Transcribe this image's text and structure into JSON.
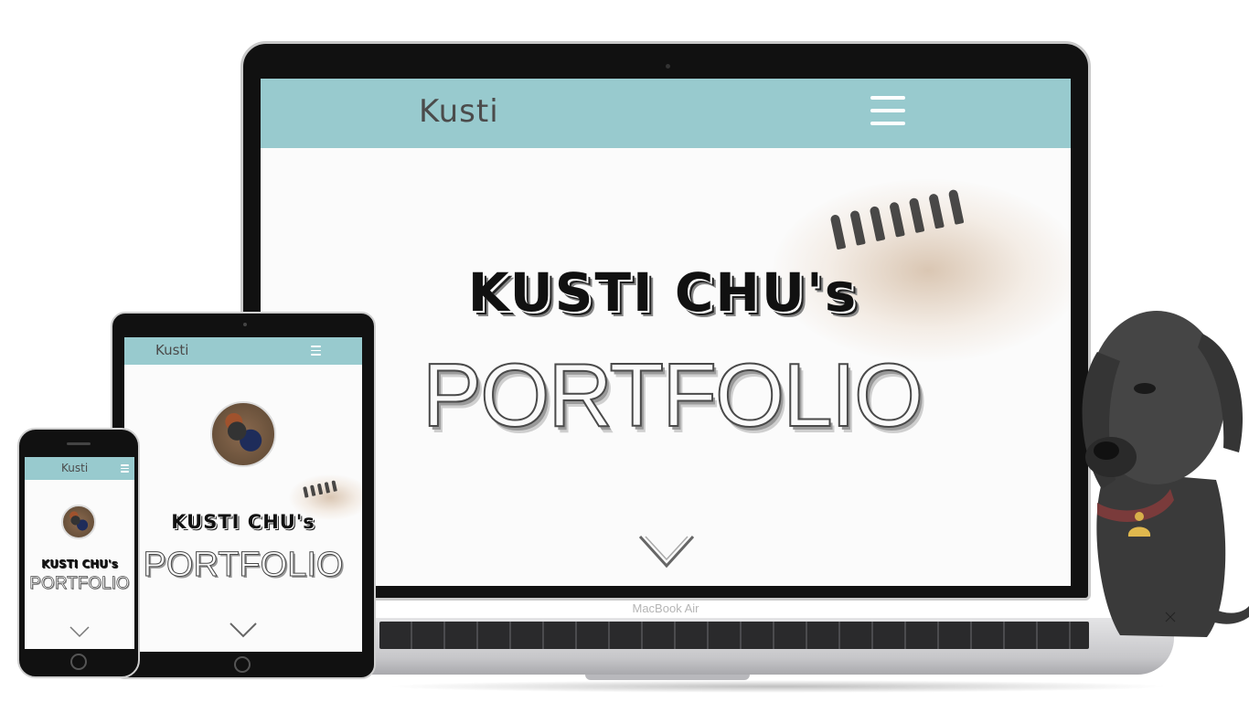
{
  "laptop": {
    "device_label": "MacBook Air",
    "site": {
      "logo_text": "Kusti",
      "title_line1": "KUSTI CHU's",
      "title_line2": "PORTFOLIO",
      "header_color": "#98cace"
    }
  },
  "tablet": {
    "site": {
      "logo_text": "Kusti",
      "menu_glyph": "☰",
      "title_line1": "KUSTI CHU's",
      "title_line2": "PORTFOLIO"
    }
  },
  "phone": {
    "site": {
      "logo_text": "Kusti",
      "menu_glyph": "☰",
      "title_line1": "KUSTI CHU's",
      "title_line2": "PORTFOLIO"
    }
  },
  "icons": {
    "menu": "hamburger-icon",
    "scroll_down": "chevron-down-icon",
    "paw": "paw-icon"
  },
  "colors": {
    "accent": "#98cace",
    "logo_paw": "#d47a63",
    "logo_text": "#4b4b4b"
  }
}
